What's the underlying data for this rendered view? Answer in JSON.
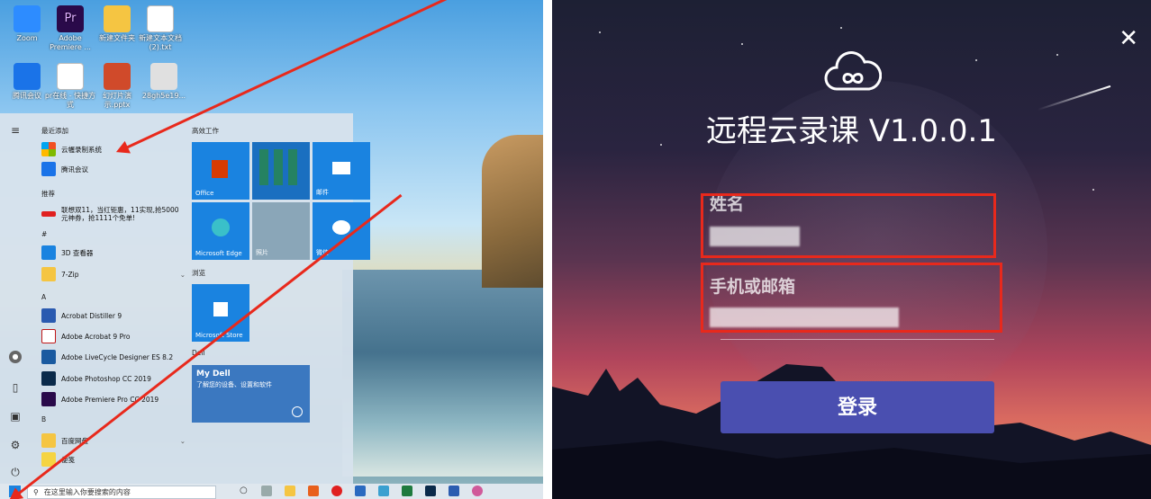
{
  "desktop": {
    "icons": [
      {
        "label": "Zoom",
        "color": "#2d8cff"
      },
      {
        "label": "Adobe Premiere ...",
        "color": "#2a0a4a"
      },
      {
        "label": "新建文件夹",
        "color": "#f5c542"
      },
      {
        "label": "新建文本文档 (2).txt",
        "color": "#ffffff"
      },
      {
        "label": "腾讯会议",
        "color": "#1a73e8"
      },
      {
        "label": "pr在线 - 快捷方式",
        "color": "#3a1a5a"
      },
      {
        "label": "幻灯片演示.pptx",
        "color": "#d04a2a"
      },
      {
        "label": "28gh5e19...",
        "color": "#e0e0e0"
      }
    ]
  },
  "startmenu": {
    "rail_icons": [
      "hamburger-icon",
      "user-icon",
      "document-icon",
      "pictures-icon",
      "settings-icon",
      "power-icon"
    ],
    "sections": {
      "recent": "最近添加",
      "recommended": "推荐",
      "hash": "#",
      "a": "A",
      "b": "B"
    },
    "apps": [
      {
        "label": "云幄录制系统",
        "color": "#e8601c"
      },
      {
        "label": "腾讯会议",
        "color": "#1a73e8"
      },
      {
        "label": "联想双11，当红钜惠，11实现,抢5000元神券，抢1111个免单!",
        "color": "#e02020"
      },
      {
        "label": "3D 查看器",
        "color": "#1a83e0"
      },
      {
        "label": "7-Zip",
        "color": "#f5c542"
      },
      {
        "label": "Acrobat Distiller 9",
        "color": "#2a5ab0"
      },
      {
        "label": "Adobe Acrobat 9 Pro",
        "color": "#c01818"
      },
      {
        "label": "Adobe LiveCycle Designer ES 8.2",
        "color": "#1a5aa0"
      },
      {
        "label": "Adobe Photoshop CC 2019",
        "color": "#0a2a4a"
      },
      {
        "label": "Adobe Premiere Pro CC 2019",
        "color": "#2a0a4a"
      },
      {
        "label": "百度网盘",
        "color": "#f5c542"
      },
      {
        "label": "便笺",
        "color": "#f5d442"
      }
    ],
    "tile_sections": {
      "productivity": "高效工作",
      "browse": "浏览",
      "dell": "Dell"
    },
    "tiles": {
      "office": "Office",
      "mail": "邮件",
      "edge": "Microsoft Edge",
      "photos": "照片",
      "wechat": "微信",
      "store": "Microsoft Store",
      "mydell_title": "My Dell",
      "mydell_sub": "了解您的设备、设置和软件"
    }
  },
  "taskbar": {
    "search_placeholder": "在这里输入你要搜索的内容"
  },
  "login": {
    "title": "远程云录课 V1.0.0.1",
    "name_label": "姓名",
    "contact_label": "手机或邮箱",
    "login_button": "登录",
    "button_color": "#4a4fb0",
    "highlight_color": "#e8291c"
  }
}
